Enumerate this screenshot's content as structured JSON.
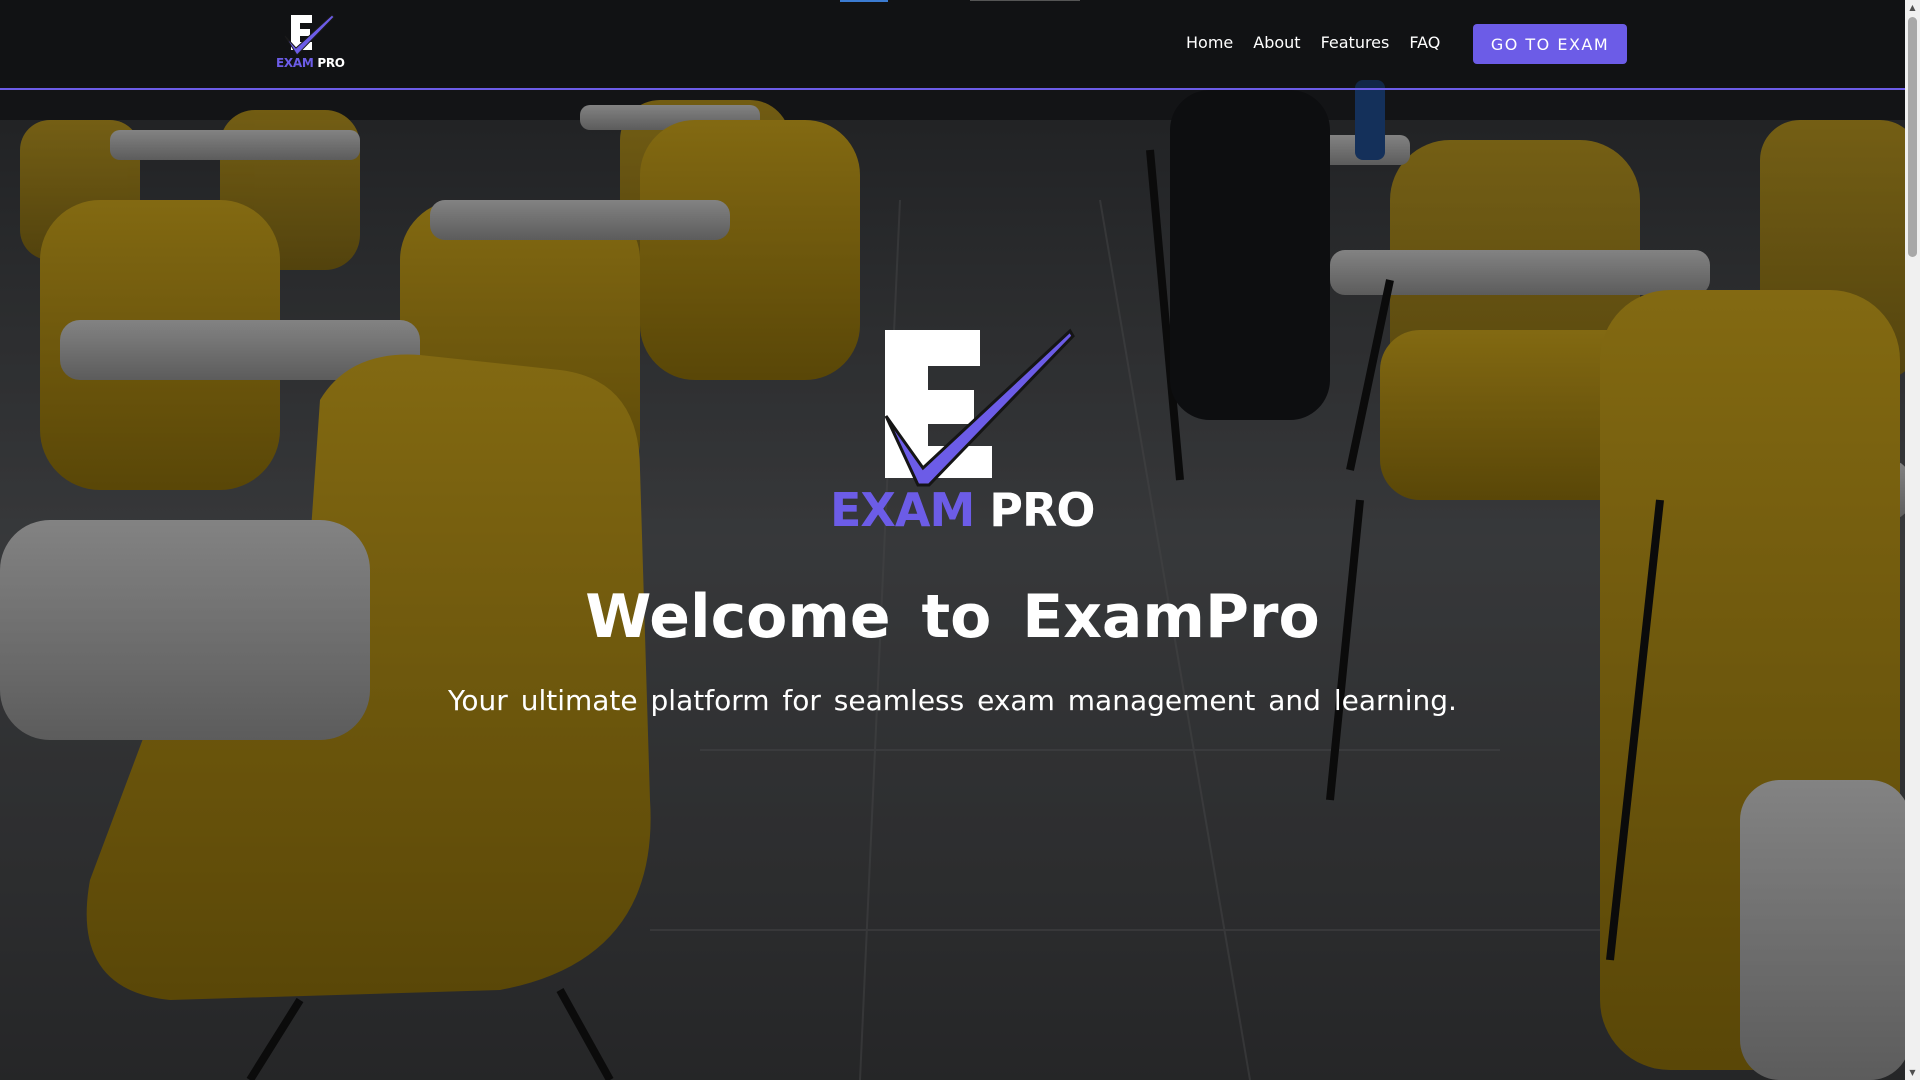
{
  "brand": {
    "logo_exam": "EXAM",
    "logo_pro": "PRO",
    "accent_color": "#6c5ce7"
  },
  "nav": {
    "links": [
      {
        "label": "Home"
      },
      {
        "label": "About"
      },
      {
        "label": "Features"
      },
      {
        "label": "FAQ"
      }
    ],
    "cta_label": "GO TO EXAM"
  },
  "hero": {
    "title": "Welcome to ExamPro",
    "subtitle": "Your ultimate platform for seamless exam management and learning."
  },
  "icons": {
    "logo_mark": "e-checkmark-logo-icon",
    "scroll_up": "arrow-up-icon",
    "scroll_down": "arrow-down-icon"
  }
}
